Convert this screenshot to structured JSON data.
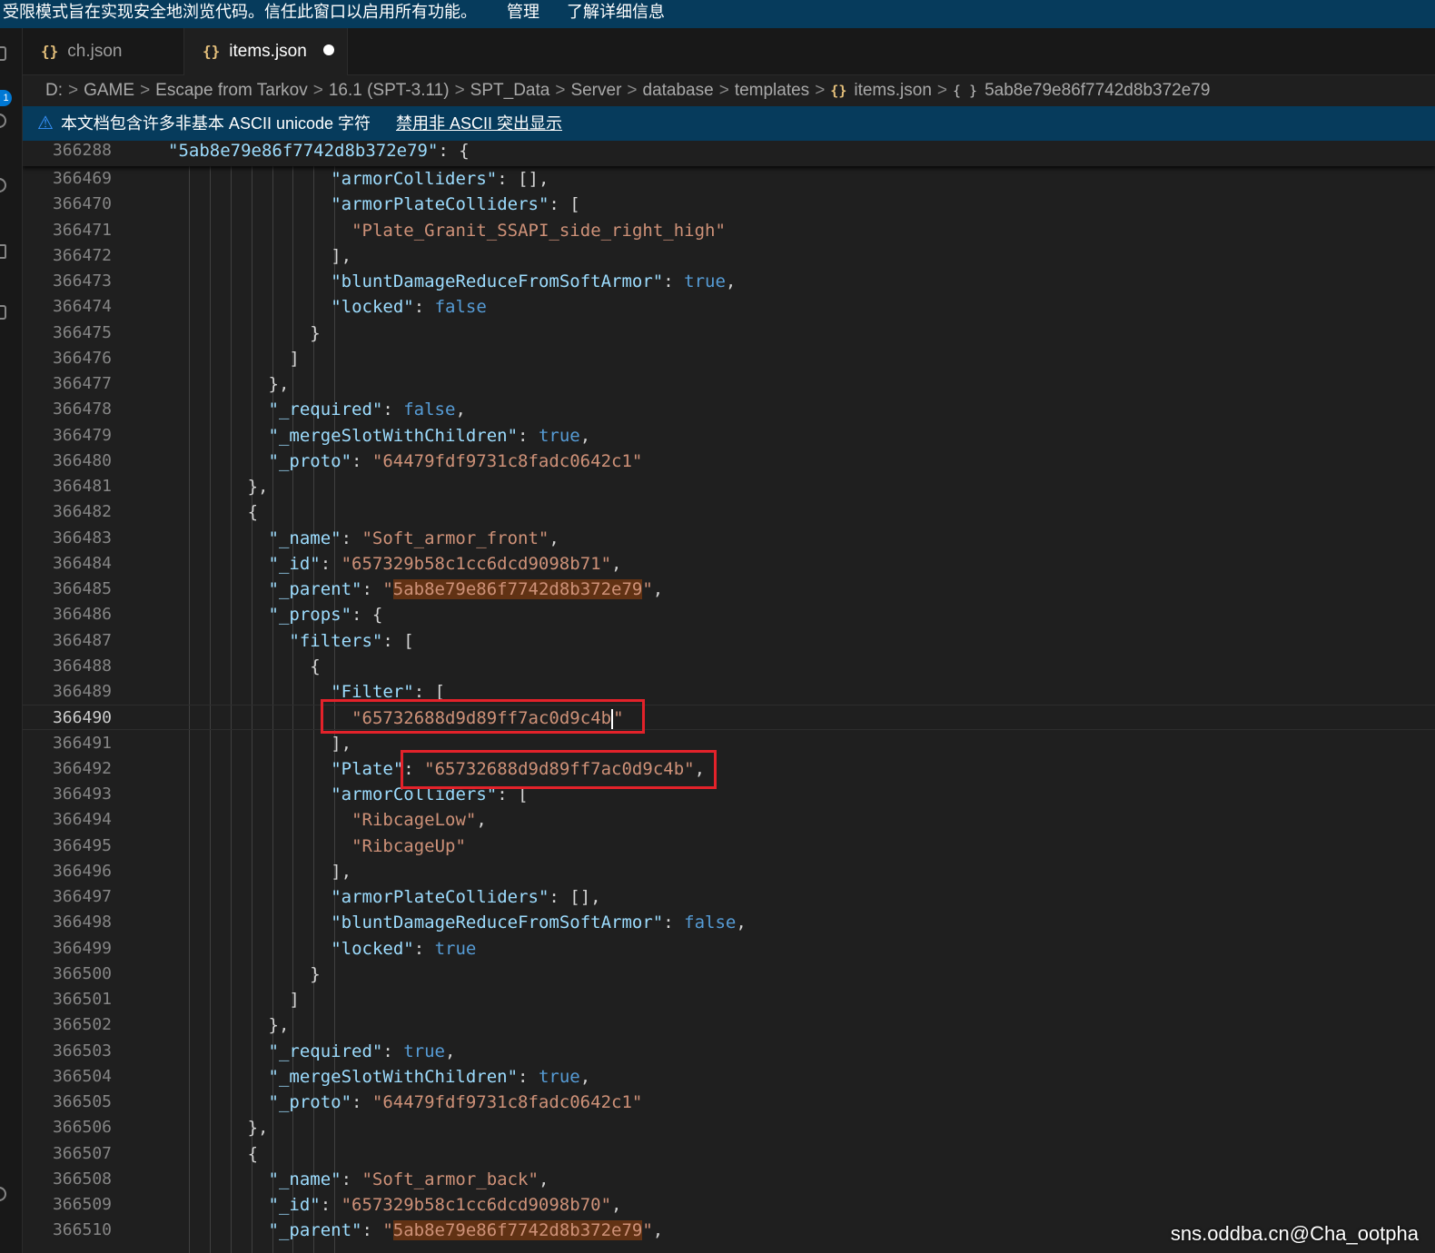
{
  "restricted_mode": {
    "message": "受限模式旨在实现安全地浏览代码。信任此窗口以启用所有功能。",
    "manage": "管理",
    "learn_more": "了解详细信息"
  },
  "activity": {
    "badge": "1"
  },
  "tabs": [
    {
      "icon": "{}",
      "label": "ch.json"
    },
    {
      "icon": "{}",
      "label": "items.json"
    }
  ],
  "breadcrumb": [
    "D:",
    "GAME",
    "Escape from Tarkov",
    "16.1 (SPT-3.11)",
    "SPT_Data",
    "Server",
    "database",
    "templates",
    "items.json",
    "5ab8e79e86f7742d8b372e79"
  ],
  "notice": {
    "message": "本文档包含许多非基本 ASCII unicode 字符",
    "action": "禁用非 ASCII 突出显示"
  },
  "sticky_line": {
    "num": "366288",
    "key": "\"5ab8e79e86f7742d8b372e79\"",
    "rest": ": {"
  },
  "lines": [
    {
      "num": "366469",
      "indent": 8,
      "parts": [
        [
          "k",
          "\"armorColliders\""
        ],
        [
          "p",
          ": [],"
        ]
      ]
    },
    {
      "num": "366470",
      "indent": 8,
      "parts": [
        [
          "k",
          "\"armorPlateColliders\""
        ],
        [
          "p",
          ": ["
        ]
      ]
    },
    {
      "num": "366471",
      "indent": 9,
      "parts": [
        [
          "s",
          "\"Plate_Granit_SSAPI_side_right_high\""
        ]
      ]
    },
    {
      "num": "366472",
      "indent": 8,
      "parts": [
        [
          "p",
          "],"
        ]
      ]
    },
    {
      "num": "366473",
      "indent": 8,
      "parts": [
        [
          "k",
          "\"bluntDamageReduceFromSoftArmor\""
        ],
        [
          "p",
          ": "
        ],
        [
          "b",
          "true"
        ],
        [
          "p",
          ","
        ]
      ]
    },
    {
      "num": "366474",
      "indent": 8,
      "parts": [
        [
          "k",
          "\"locked\""
        ],
        [
          "p",
          ": "
        ],
        [
          "b",
          "false"
        ]
      ]
    },
    {
      "num": "366475",
      "indent": 7,
      "parts": [
        [
          "p",
          "}"
        ]
      ]
    },
    {
      "num": "366476",
      "indent": 6,
      "parts": [
        [
          "p",
          "]"
        ]
      ]
    },
    {
      "num": "366477",
      "indent": 5,
      "parts": [
        [
          "p",
          "},"
        ]
      ]
    },
    {
      "num": "366478",
      "indent": 5,
      "parts": [
        [
          "k",
          "\"_required\""
        ],
        [
          "p",
          ": "
        ],
        [
          "b",
          "false"
        ],
        [
          "p",
          ","
        ]
      ]
    },
    {
      "num": "366479",
      "indent": 5,
      "parts": [
        [
          "k",
          "\"_mergeSlotWithChildren\""
        ],
        [
          "p",
          ": "
        ],
        [
          "b",
          "true"
        ],
        [
          "p",
          ","
        ]
      ]
    },
    {
      "num": "366480",
      "indent": 5,
      "parts": [
        [
          "k",
          "\"_proto\""
        ],
        [
          "p",
          ": "
        ],
        [
          "s",
          "\"64479fdf9731c8fadc0642c1\""
        ]
      ]
    },
    {
      "num": "366481",
      "indent": 4,
      "parts": [
        [
          "p",
          "},"
        ]
      ]
    },
    {
      "num": "366482",
      "indent": 4,
      "parts": [
        [
          "p",
          "{"
        ]
      ]
    },
    {
      "num": "366483",
      "indent": 5,
      "parts": [
        [
          "k",
          "\"_name\""
        ],
        [
          "p",
          ": "
        ],
        [
          "s",
          "\"Soft_armor_front\""
        ],
        [
          "p",
          ","
        ]
      ]
    },
    {
      "num": "366484",
      "indent": 5,
      "parts": [
        [
          "k",
          "\"_id\""
        ],
        [
          "p",
          ": "
        ],
        [
          "s",
          "\"657329b58c1cc6dcd9098b71\""
        ],
        [
          "p",
          ","
        ]
      ]
    },
    {
      "num": "366485",
      "indent": 5,
      "parts": [
        [
          "k",
          "\"_parent\""
        ],
        [
          "p",
          ": "
        ],
        [
          "s",
          "\""
        ],
        [
          "h",
          "5ab8e79e86f7742d8b372e79"
        ],
        [
          "s",
          "\""
        ],
        [
          "p",
          ","
        ]
      ]
    },
    {
      "num": "366486",
      "indent": 5,
      "parts": [
        [
          "k",
          "\"_props\""
        ],
        [
          "p",
          ": {"
        ]
      ]
    },
    {
      "num": "366487",
      "indent": 6,
      "parts": [
        [
          "k",
          "\"filters\""
        ],
        [
          "p",
          ": ["
        ]
      ]
    },
    {
      "num": "366488",
      "indent": 7,
      "parts": [
        [
          "p",
          "{"
        ]
      ]
    },
    {
      "num": "366489",
      "indent": 8,
      "parts": [
        [
          "k",
          "\"Filter\""
        ],
        [
          "p",
          ": ["
        ]
      ]
    },
    {
      "num": "366490",
      "indent": 9,
      "current": true,
      "parts": [
        [
          "s",
          "\"65732688d9d89ff7ac0d9c4b"
        ],
        [
          "c",
          ""
        ],
        [
          "s",
          "\""
        ]
      ]
    },
    {
      "num": "366491",
      "indent": 8,
      "parts": [
        [
          "p",
          "],"
        ]
      ]
    },
    {
      "num": "366492",
      "indent": 8,
      "parts": [
        [
          "k",
          "\"Plate\""
        ],
        [
          "p",
          ": "
        ],
        [
          "s",
          "\"65732688d9d89ff7ac0d9c4b\""
        ],
        [
          "p",
          ","
        ]
      ]
    },
    {
      "num": "366493",
      "indent": 8,
      "parts": [
        [
          "k",
          "\"armorColliders\""
        ],
        [
          "p",
          ": ["
        ]
      ]
    },
    {
      "num": "366494",
      "indent": 9,
      "parts": [
        [
          "s",
          "\"RibcageLow\""
        ],
        [
          "p",
          ","
        ]
      ]
    },
    {
      "num": "366495",
      "indent": 9,
      "parts": [
        [
          "s",
          "\"RibcageUp\""
        ]
      ]
    },
    {
      "num": "366496",
      "indent": 8,
      "parts": [
        [
          "p",
          "],"
        ]
      ]
    },
    {
      "num": "366497",
      "indent": 8,
      "parts": [
        [
          "k",
          "\"armorPlateColliders\""
        ],
        [
          "p",
          ": [],"
        ]
      ]
    },
    {
      "num": "366498",
      "indent": 8,
      "parts": [
        [
          "k",
          "\"bluntDamageReduceFromSoftArmor\""
        ],
        [
          "p",
          ": "
        ],
        [
          "b",
          "false"
        ],
        [
          "p",
          ","
        ]
      ]
    },
    {
      "num": "366499",
      "indent": 8,
      "parts": [
        [
          "k",
          "\"locked\""
        ],
        [
          "p",
          ": "
        ],
        [
          "b",
          "true"
        ]
      ]
    },
    {
      "num": "366500",
      "indent": 7,
      "parts": [
        [
          "p",
          "}"
        ]
      ]
    },
    {
      "num": "366501",
      "indent": 6,
      "parts": [
        [
          "p",
          "]"
        ]
      ]
    },
    {
      "num": "366502",
      "indent": 5,
      "parts": [
        [
          "p",
          "},"
        ]
      ]
    },
    {
      "num": "366503",
      "indent": 5,
      "parts": [
        [
          "k",
          "\"_required\""
        ],
        [
          "p",
          ": "
        ],
        [
          "b",
          "true"
        ],
        [
          "p",
          ","
        ]
      ]
    },
    {
      "num": "366504",
      "indent": 5,
      "parts": [
        [
          "k",
          "\"_mergeSlotWithChildren\""
        ],
        [
          "p",
          ": "
        ],
        [
          "b",
          "true"
        ],
        [
          "p",
          ","
        ]
      ]
    },
    {
      "num": "366505",
      "indent": 5,
      "parts": [
        [
          "k",
          "\"_proto\""
        ],
        [
          "p",
          ": "
        ],
        [
          "s",
          "\"64479fdf9731c8fadc0642c1\""
        ]
      ]
    },
    {
      "num": "366506",
      "indent": 4,
      "parts": [
        [
          "p",
          "},"
        ]
      ]
    },
    {
      "num": "366507",
      "indent": 4,
      "parts": [
        [
          "p",
          "{"
        ]
      ]
    },
    {
      "num": "366508",
      "indent": 5,
      "parts": [
        [
          "k",
          "\"_name\""
        ],
        [
          "p",
          ": "
        ],
        [
          "s",
          "\"Soft_armor_back\""
        ],
        [
          "p",
          ","
        ]
      ]
    },
    {
      "num": "366509",
      "indent": 5,
      "parts": [
        [
          "k",
          "\"_id\""
        ],
        [
          "p",
          ": "
        ],
        [
          "s",
          "\"657329b58c1cc6dcd9098b70\""
        ],
        [
          "p",
          ","
        ]
      ]
    },
    {
      "num": "366510",
      "indent": 5,
      "parts": [
        [
          "k",
          "\"_parent\""
        ],
        [
          "p",
          ": "
        ],
        [
          "s",
          "\""
        ],
        [
          "h",
          "5ab8e79e86f7742d8b372e79"
        ],
        [
          "s",
          "\""
        ],
        [
          "p",
          ","
        ]
      ]
    }
  ],
  "watermark": "sns.oddba.cn@Cha_ootpha"
}
